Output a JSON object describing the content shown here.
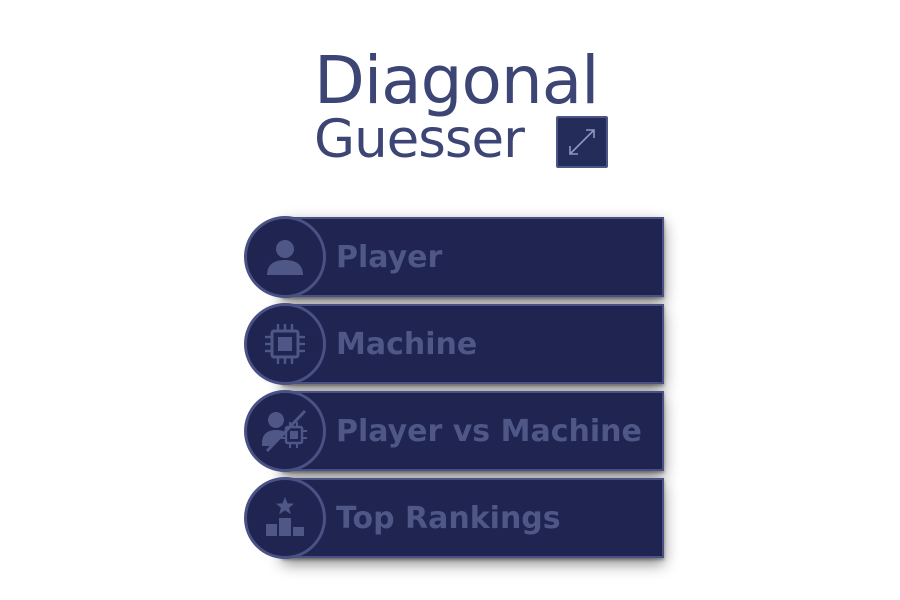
{
  "logo": {
    "line1": "Diagonal",
    "line2": "Guesser",
    "icon": "diagonal-arrow-icon"
  },
  "menu": {
    "items": [
      {
        "label": "Player",
        "icon": "user-icon"
      },
      {
        "label": "Machine",
        "icon": "cpu-chip-icon"
      },
      {
        "label": "Player vs Machine",
        "icon": "user-vs-chip-icon"
      },
      {
        "label": "Top Rankings",
        "icon": "podium-star-icon"
      }
    ]
  },
  "colors": {
    "background": "#ffffff",
    "logo_text": "#3c4574",
    "button_fill": "#1f2550",
    "button_border": "#4a5285",
    "button_text": "#4e5785"
  }
}
